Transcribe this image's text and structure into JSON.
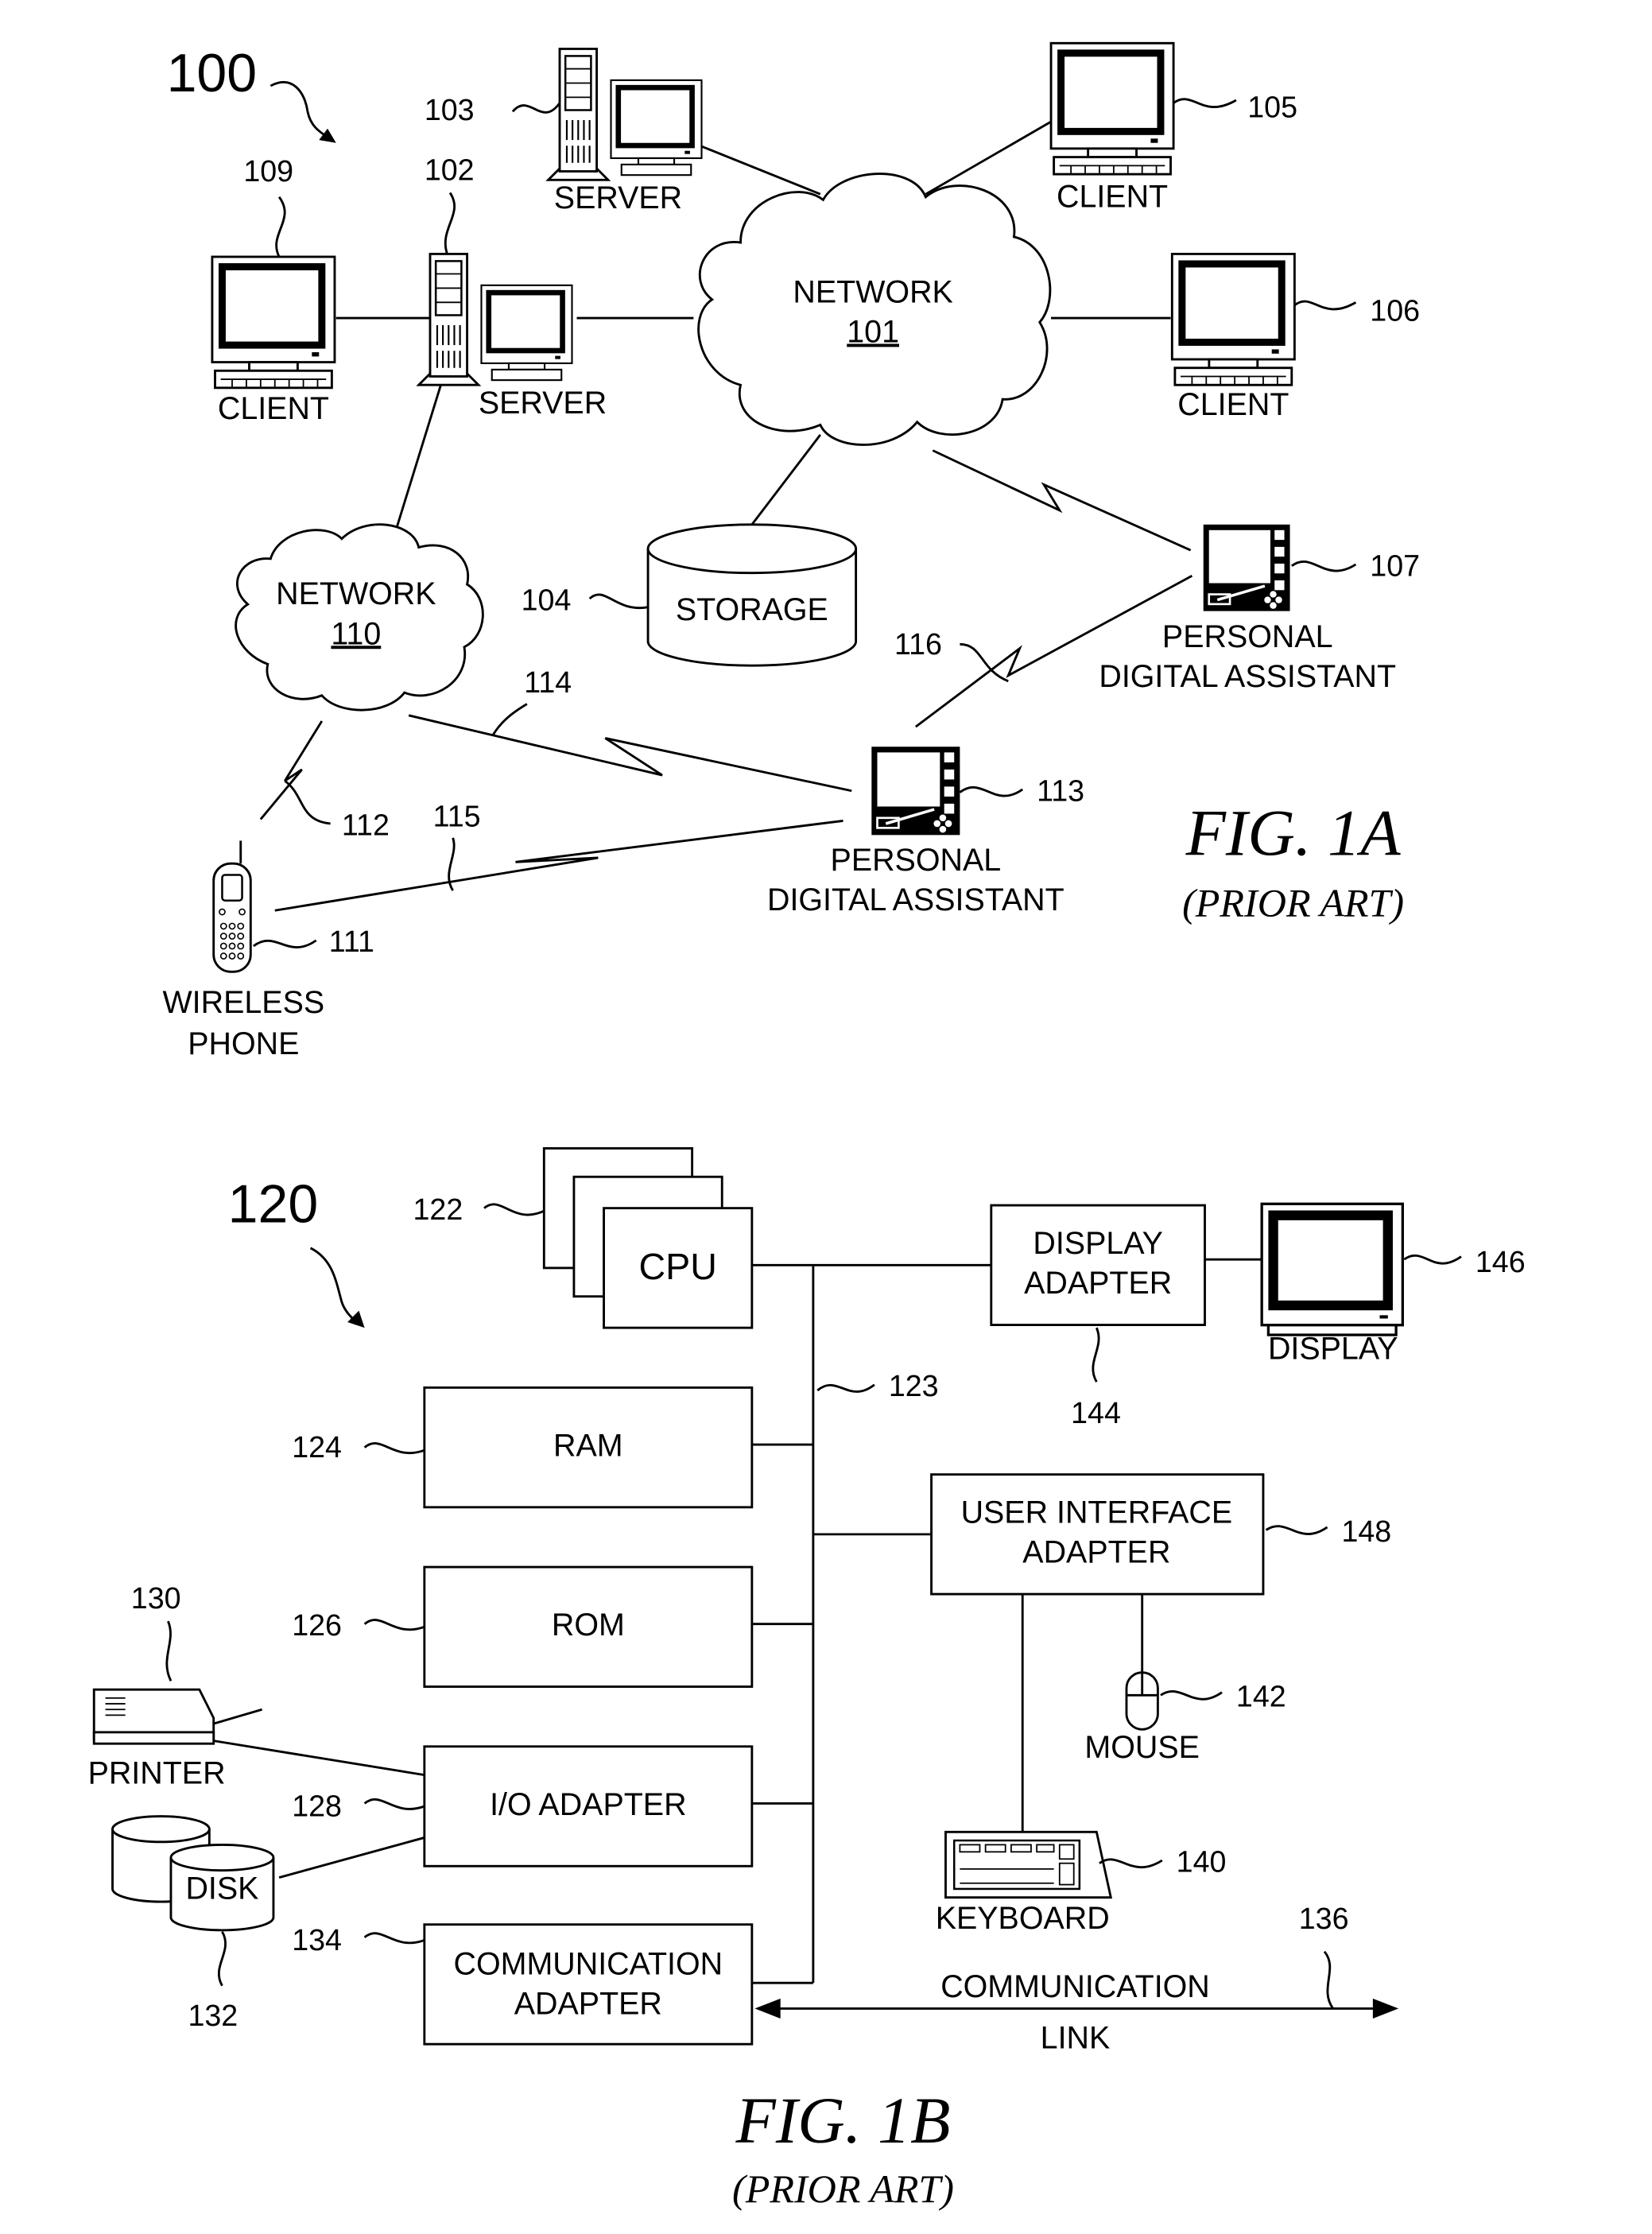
{
  "figure_1a": {
    "ref": "100",
    "title": "FIG. 1A",
    "subtitle": "(PRIOR ART)",
    "network_101": {
      "label": "NETWORK",
      "number": "101"
    },
    "network_110": {
      "label": "NETWORK",
      "number": "110"
    },
    "server_102": {
      "label": "SERVER",
      "ref": "102"
    },
    "server_103": {
      "label": "SERVER",
      "ref": "103"
    },
    "storage_104": {
      "label": "STORAGE",
      "ref": "104"
    },
    "client_105": {
      "label": "CLIENT",
      "ref": "105"
    },
    "client_106": {
      "label": "CLIENT",
      "ref": "106"
    },
    "client_109": {
      "label": "CLIENT",
      "ref": "109"
    },
    "pda_107": {
      "label_line1": "PERSONAL",
      "label_line2": "DIGITAL ASSISTANT",
      "ref": "107"
    },
    "pda_113": {
      "label_line1": "PERSONAL",
      "label_line2": "DIGITAL ASSISTANT",
      "ref": "113"
    },
    "phone_111": {
      "label_line1": "WIRELESS",
      "label_line2": "PHONE",
      "ref": "111"
    },
    "links": {
      "l112": "112",
      "l114": "114",
      "l115": "115",
      "l116": "116"
    }
  },
  "figure_1b": {
    "ref": "120",
    "title": "FIG. 1B",
    "subtitle": "(PRIOR ART)",
    "cpu": {
      "label": "CPU",
      "ref": "122"
    },
    "bus": {
      "ref": "123"
    },
    "ram": {
      "label": "RAM",
      "ref": "124"
    },
    "rom": {
      "label": "ROM",
      "ref": "126"
    },
    "io_adapter": {
      "label": "I/O ADAPTER",
      "ref": "128"
    },
    "comm_adapter": {
      "label_line1": "COMMUNICATION",
      "label_line2": "ADAPTER",
      "ref": "134"
    },
    "printer": {
      "label": "PRINTER",
      "ref": "130"
    },
    "disk": {
      "label": "DISK",
      "ref": "132"
    },
    "display_adapter": {
      "label_line1": "DISPLAY",
      "label_line2": "ADAPTER",
      "ref": "144"
    },
    "display": {
      "label": "DISPLAY",
      "ref": "146"
    },
    "ui_adapter": {
      "label_line1": "USER INTERFACE",
      "label_line2": "ADAPTER",
      "ref": "148"
    },
    "mouse": {
      "label": "MOUSE",
      "ref": "142"
    },
    "keyboard": {
      "label": "KEYBOARD",
      "ref": "140"
    },
    "comm_link": {
      "label_line1": "COMMUNICATION",
      "label_line2": "LINK",
      "ref": "136"
    }
  }
}
